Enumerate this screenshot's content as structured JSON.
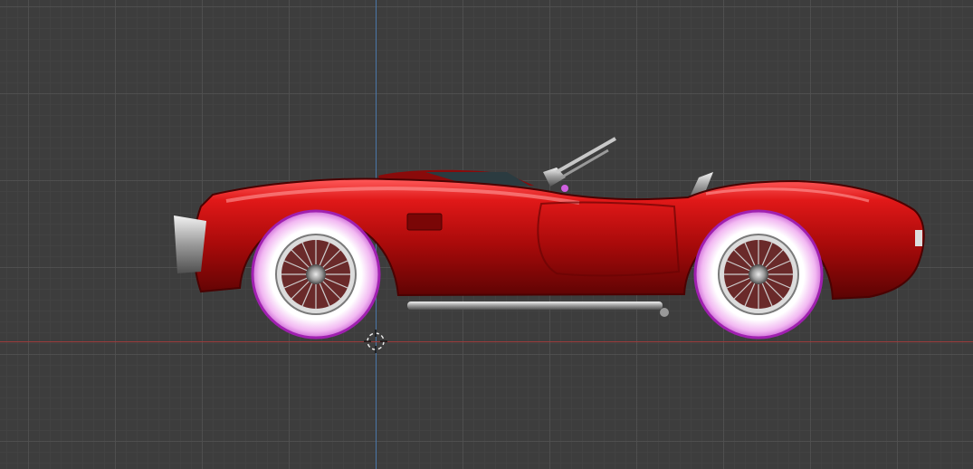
{
  "viewport": {
    "background_color": "#3d3d3d",
    "grid_major_color": "#505050",
    "grid_minor_color": "#444444",
    "y_axis_color": "#4a76a8",
    "x_axis_color": "#9c3b3b"
  },
  "model": {
    "object": "roadster-car",
    "body_color": "#b50d0d",
    "tire_color": "#f5c4f5",
    "tire_outline_color": "#a020b0",
    "chrome_color": "#c8c8c8"
  },
  "icons": {
    "cursor": "3d-cursor-icon"
  }
}
